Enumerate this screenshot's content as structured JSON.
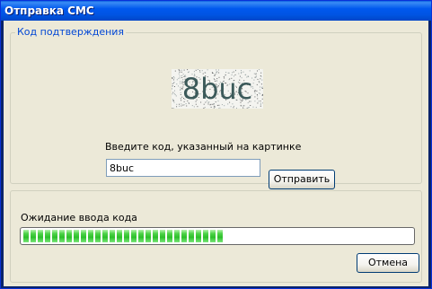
{
  "window": {
    "title": "Отправка СМС"
  },
  "verification": {
    "legend": "Код подтверждения",
    "captcha_text": "8buc",
    "hint": "Введите код, указанный на картинке",
    "code_value": "8buc",
    "send_label": "Отправить"
  },
  "status": {
    "wait_label": "Ожидание ввода кода",
    "progress_fraction": 0.52,
    "cancel_label": "Отмена"
  },
  "colors": {
    "titlebar": "#0054e3",
    "legend_text": "#0046d5",
    "progress_fill": "#2cbf2a",
    "dialog_bg": "#ece9d8"
  }
}
